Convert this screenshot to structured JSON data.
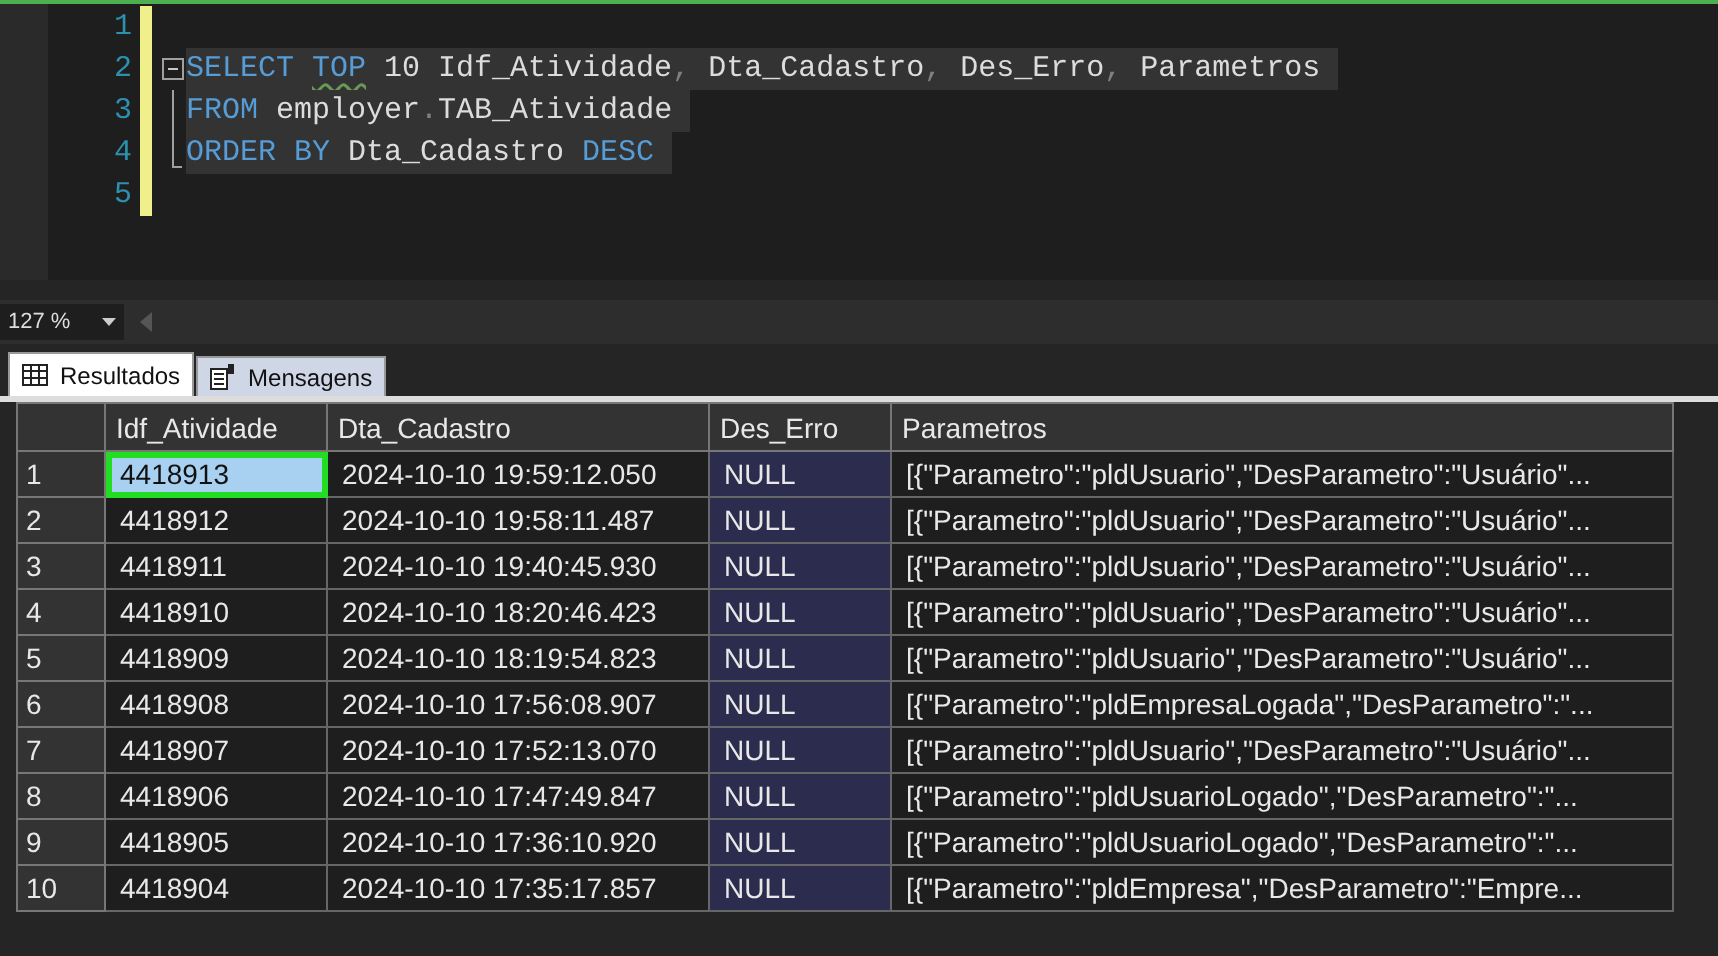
{
  "editor": {
    "lines": [
      {
        "number": "1",
        "kind": "plain"
      },
      {
        "number": "2",
        "kind": "fold-start",
        "tokens": [
          {
            "kind": "keyword",
            "text": "SELECT "
          },
          {
            "kind": "keyword-warn",
            "text": "TOP"
          },
          {
            "kind": "ident",
            "text": " 10 Idf_Atividade"
          },
          {
            "kind": "punct",
            "text": ", "
          },
          {
            "kind": "ident",
            "text": "Dta_Cadastro"
          },
          {
            "kind": "punct",
            "text": ", "
          },
          {
            "kind": "ident",
            "text": "Des_Erro"
          },
          {
            "kind": "punct",
            "text": ", "
          },
          {
            "kind": "ident",
            "text": "Parametros "
          }
        ]
      },
      {
        "number": "3",
        "kind": "fold-inner",
        "tokens": [
          {
            "kind": "keyword",
            "text": "FROM "
          },
          {
            "kind": "ident",
            "text": "employer"
          },
          {
            "kind": "punct",
            "text": "."
          },
          {
            "kind": "ident",
            "text": "TAB_Atividade "
          }
        ]
      },
      {
        "number": "4",
        "kind": "fold-end",
        "tokens": [
          {
            "kind": "keyword",
            "text": "ORDER BY "
          },
          {
            "kind": "ident",
            "text": "Dta_Cadastro "
          },
          {
            "kind": "keyword",
            "text": "DESC "
          }
        ]
      },
      {
        "number": "5",
        "kind": "plain"
      }
    ]
  },
  "zoom": {
    "value": "127 %"
  },
  "tabs": [
    {
      "label": "Resultados",
      "selected": true
    },
    {
      "label": "Mensagens",
      "selected": false
    }
  ],
  "grid": {
    "columns": [
      "Idf_Atividade",
      "Dta_Cadastro",
      "Des_Erro",
      "Parametros"
    ],
    "rows": [
      {
        "number": "1",
        "cells": [
          {
            "text": "4418913",
            "kind": "value",
            "selected": true
          },
          {
            "text": "2024-10-10 19:59:12.050",
            "kind": "value",
            "selected": false
          },
          {
            "text": "NULL",
            "kind": "null",
            "selected": false
          },
          {
            "text": "[{\"Parametro\":\"pldUsuario\",\"DesParametro\":\"Usuário\"...",
            "kind": "value",
            "selected": false
          }
        ]
      },
      {
        "number": "2",
        "cells": [
          {
            "text": "4418912",
            "kind": "value",
            "selected": false
          },
          {
            "text": "2024-10-10 19:58:11.487",
            "kind": "value",
            "selected": false
          },
          {
            "text": "NULL",
            "kind": "null",
            "selected": false
          },
          {
            "text": "[{\"Parametro\":\"pldUsuario\",\"DesParametro\":\"Usuário\"...",
            "kind": "value",
            "selected": false
          }
        ]
      },
      {
        "number": "3",
        "cells": [
          {
            "text": "4418911",
            "kind": "value",
            "selected": false
          },
          {
            "text": "2024-10-10 19:40:45.930",
            "kind": "value",
            "selected": false
          },
          {
            "text": "NULL",
            "kind": "null",
            "selected": false
          },
          {
            "text": "[{\"Parametro\":\"pldUsuario\",\"DesParametro\":\"Usuário\"...",
            "kind": "value",
            "selected": false
          }
        ]
      },
      {
        "number": "4",
        "cells": [
          {
            "text": "4418910",
            "kind": "value",
            "selected": false
          },
          {
            "text": "2024-10-10 18:20:46.423",
            "kind": "value",
            "selected": false
          },
          {
            "text": "NULL",
            "kind": "null",
            "selected": false
          },
          {
            "text": "[{\"Parametro\":\"pldUsuario\",\"DesParametro\":\"Usuário\"...",
            "kind": "value",
            "selected": false
          }
        ]
      },
      {
        "number": "5",
        "cells": [
          {
            "text": "4418909",
            "kind": "value",
            "selected": false
          },
          {
            "text": "2024-10-10 18:19:54.823",
            "kind": "value",
            "selected": false
          },
          {
            "text": "NULL",
            "kind": "null",
            "selected": false
          },
          {
            "text": "[{\"Parametro\":\"pldUsuario\",\"DesParametro\":\"Usuário\"...",
            "kind": "value",
            "selected": false
          }
        ]
      },
      {
        "number": "6",
        "cells": [
          {
            "text": "4418908",
            "kind": "value",
            "selected": false
          },
          {
            "text": "2024-10-10 17:56:08.907",
            "kind": "value",
            "selected": false
          },
          {
            "text": "NULL",
            "kind": "null",
            "selected": false
          },
          {
            "text": "[{\"Parametro\":\"pldEmpresaLogada\",\"DesParametro\":\"...",
            "kind": "value",
            "selected": false
          }
        ]
      },
      {
        "number": "7",
        "cells": [
          {
            "text": "4418907",
            "kind": "value",
            "selected": false
          },
          {
            "text": "2024-10-10 17:52:13.070",
            "kind": "value",
            "selected": false
          },
          {
            "text": "NULL",
            "kind": "null",
            "selected": false
          },
          {
            "text": "[{\"Parametro\":\"pldUsuario\",\"DesParametro\":\"Usuário\"...",
            "kind": "value",
            "selected": false
          }
        ]
      },
      {
        "number": "8",
        "cells": [
          {
            "text": "4418906",
            "kind": "value",
            "selected": false
          },
          {
            "text": "2024-10-10 17:47:49.847",
            "kind": "value",
            "selected": false
          },
          {
            "text": "NULL",
            "kind": "null",
            "selected": false
          },
          {
            "text": "[{\"Parametro\":\"pldUsuarioLogado\",\"DesParametro\":\"...",
            "kind": "value",
            "selected": false
          }
        ]
      },
      {
        "number": "9",
        "cells": [
          {
            "text": "4418905",
            "kind": "value",
            "selected": false
          },
          {
            "text": "2024-10-10 17:36:10.920",
            "kind": "value",
            "selected": false
          },
          {
            "text": "NULL",
            "kind": "null",
            "selected": false
          },
          {
            "text": "[{\"Parametro\":\"pldUsuarioLogado\",\"DesParametro\":\"...",
            "kind": "value",
            "selected": false
          }
        ]
      },
      {
        "number": "10",
        "cells": [
          {
            "text": "4418904",
            "kind": "value",
            "selected": false
          },
          {
            "text": "2024-10-10 17:35:17.857",
            "kind": "value",
            "selected": false
          },
          {
            "text": "NULL",
            "kind": "null",
            "selected": false
          },
          {
            "text": "[{\"Parametro\":\"pldEmpresa\",\"DesParametro\":\"Empre...",
            "kind": "value",
            "selected": false
          }
        ]
      }
    ]
  }
}
